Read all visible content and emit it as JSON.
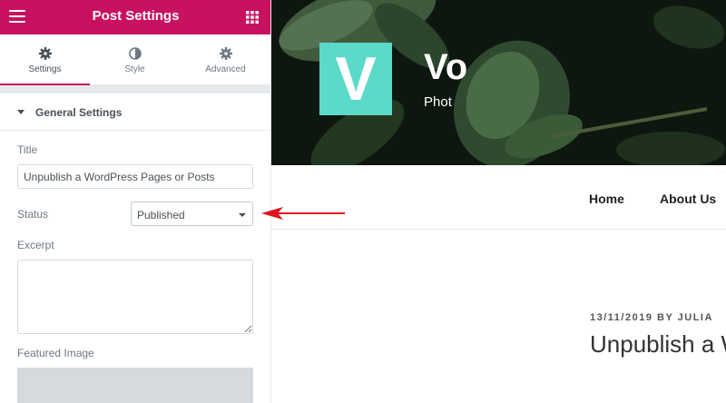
{
  "panel": {
    "title": "Post Settings",
    "tabs": [
      {
        "label": "Settings",
        "icon": "gear-icon",
        "active": true
      },
      {
        "label": "Style",
        "icon": "contrast-icon",
        "active": false
      },
      {
        "label": "Advanced",
        "icon": "gear-icon",
        "active": false
      }
    ],
    "section": {
      "label": "General Settings"
    },
    "fields": {
      "title_label": "Title",
      "title_value": "Unpublish a WordPress Pages or Posts",
      "status_label": "Status",
      "status_value": "Published",
      "excerpt_label": "Excerpt",
      "excerpt_value": "",
      "featured_image_label": "Featured Image"
    }
  },
  "site": {
    "logo_letter": "V",
    "name_partial": "Vo",
    "tagline_partial": "Phot",
    "nav": [
      "Home",
      "About Us"
    ],
    "post": {
      "meta": "13/11/2019 BY JULIA",
      "title_partial": "Unpublish a W"
    }
  },
  "colors": {
    "accent": "#c8115f",
    "logo_bg": "#5bd9c9",
    "annotation_arrow": "#e0141e"
  }
}
